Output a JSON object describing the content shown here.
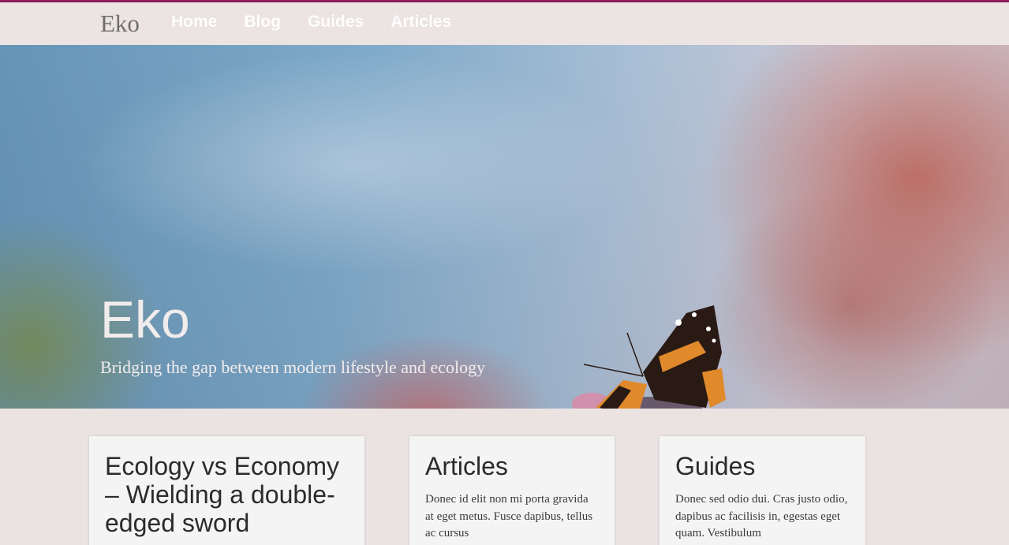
{
  "header": {
    "brand": "Eko",
    "nav": [
      {
        "label": "Home"
      },
      {
        "label": "Blog"
      },
      {
        "label": "Guides"
      },
      {
        "label": "Articles"
      }
    ],
    "accent_color": "#8b1e5b"
  },
  "hero": {
    "title": "Eko",
    "subtitle": "Bridging the gap between modern lifestyle and ecology"
  },
  "cards": [
    {
      "title": "Ecology vs Economy – Wielding a double-edged sword",
      "text": ""
    },
    {
      "title": "Articles",
      "text": "Donec id elit non mi porta gravida at eget metus. Fusce dapibus, tellus ac cursus"
    },
    {
      "title": "Guides",
      "text": "Donec sed odio dui. Cras justo odio, dapibus ac facilisis in, egestas eget quam. Vestibulum"
    }
  ]
}
